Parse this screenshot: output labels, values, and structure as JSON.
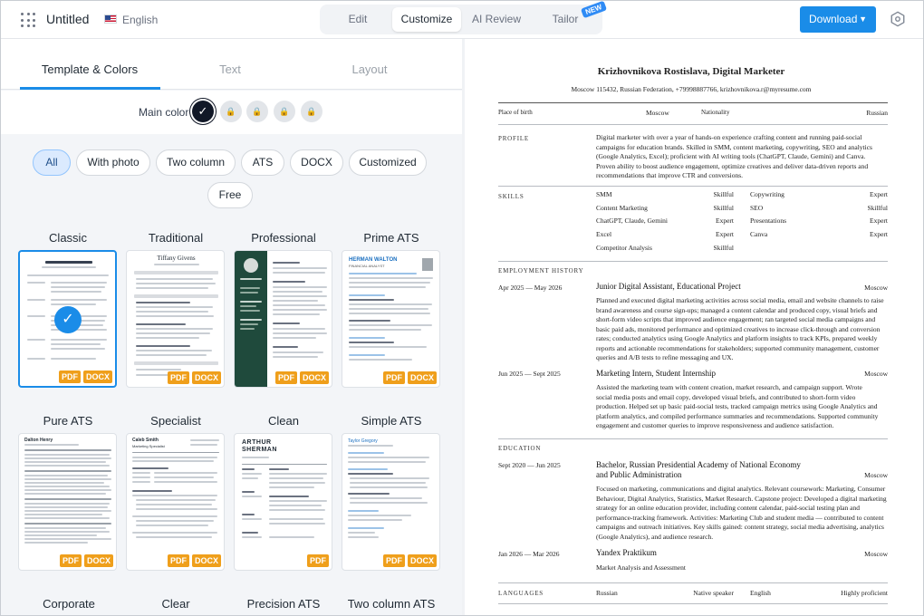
{
  "topbar": {
    "doc_title": "Untitled",
    "language": "English",
    "tabs": [
      "Edit",
      "Customize",
      "AI Review",
      "Tailor"
    ],
    "active_tab": "Customize",
    "new_badge": "NEW",
    "download_label": "Download"
  },
  "left": {
    "sub_tabs": [
      "Template & Colors",
      "Text",
      "Layout"
    ],
    "main_color_label": "Main color",
    "filters": [
      "All",
      "With photo",
      "Two column",
      "ATS",
      "DOCX",
      "Customized",
      "Free"
    ],
    "templates": [
      {
        "name": "Classic",
        "selected": true
      },
      {
        "name": "Traditional"
      },
      {
        "name": "Professional"
      },
      {
        "name": "Prime ATS"
      },
      {
        "name": "Pure ATS"
      },
      {
        "name": "Specialist"
      },
      {
        "name": "Clean"
      },
      {
        "name": "Simple ATS"
      },
      {
        "name": "Corporate"
      },
      {
        "name": "Clear"
      },
      {
        "name": "Precision ATS"
      },
      {
        "name": "Two column ATS"
      }
    ],
    "badge_pdf": "PDF",
    "badge_docx": "DOCX",
    "thumb_texts": {
      "traditional_name": "Tiffany Givens",
      "prime_name": "HERMAN WALTON",
      "prime_role": "FINANCIAL ANALYST",
      "pure_name": "Dalton Henry",
      "specialist_name": "Caleb Smith",
      "specialist_role": "Marketing Specialist",
      "clean_name_1": "ARTHUR",
      "clean_name_2": "SHERMAN",
      "simple_name": "Taylor Gregory"
    }
  },
  "resume": {
    "name": "Krizhovnikova Rostislava, Digital Marketer",
    "contact": "Moscow 115432, Russian Federation, +79998887766, krizhovnikova.r@myresume.com",
    "place_of_birth_label": "Place of birth",
    "place_of_birth": "Moscow",
    "nationality_label": "Nationality",
    "nationality": "Russian",
    "profile_label": "PROFILE",
    "profile_lines": [
      "Digital marketer with over a year of hands-on experience crafting content and running paid-social",
      "campaigns for education brands. Skilled in SMM, content marketing, copywriting, SEO and analytics",
      "(Google Analytics, Excel); proficient with AI writing tools (ChatGPT, Claude, Gemini) and Canva.",
      "Proven ability to boost audience engagement, optimize creatives and deliver data-driven reports and",
      "recommendations that improve CTR and conversions."
    ],
    "skills_label": "SKILLS",
    "skills_left": [
      {
        "name": "SMM",
        "level": "Skillful"
      },
      {
        "name": "Content Marketing",
        "level": "Skillful"
      },
      {
        "name": "ChatGPT, Claude, Gemini",
        "level": "Expert"
      },
      {
        "name": "Excel",
        "level": "Expert"
      },
      {
        "name": "Competitor Analysis",
        "level": "Skillful"
      }
    ],
    "skills_right": [
      {
        "name": "Copywriting",
        "level": "Expert"
      },
      {
        "name": "SEO",
        "level": "Skillful"
      },
      {
        "name": "Presentations",
        "level": "Expert"
      },
      {
        "name": "Canva",
        "level": "Expert"
      }
    ],
    "employment_label": "EMPLOYMENT HISTORY",
    "jobs": [
      {
        "dates": "Apr 2025 — May 2026",
        "title": "Junior Digital Assistant, Educational Project",
        "city": "Moscow",
        "lines": [
          "Planned and executed digital marketing activities across social media, email and website channels to raise",
          "brand awareness and course sign-ups; managed a content calendar and produced copy, visual briefs and",
          "short-form video scripts that improved audience engagement; ran targeted social media campaigns and",
          "basic paid ads, monitored performance and optimized creatives to increase click-through and conversion",
          "rates; conducted analytics using Google Analytics and platform insights to track KPIs, prepared weekly",
          "reports and actionable recommendations for stakeholders; supported community management, customer",
          "queries and A/B tests to refine messaging and UX."
        ]
      },
      {
        "dates": "Jun 2025 — Sept 2025",
        "title": "Marketing Intern, Student Internship",
        "city": "Moscow",
        "lines": [
          "Assisted the marketing team with content creation, market research, and campaign support. Wrote",
          "social media posts and email copy, developed visual briefs, and contributed to short-form video",
          "production. Helped set up basic paid-social tests, tracked campaign metrics using Google Analytics and",
          "platform analytics, and compiled performance summaries and recommendations. Supported community",
          "engagement and customer queries to improve responsiveness and audience satisfaction."
        ]
      }
    ],
    "education_label": "EDUCATION",
    "education": [
      {
        "dates": "Sept 2020 — Jun 2025",
        "title_lines": [
          "Bachelor, Russian Presidential Academy of National Economy",
          "and Public Administration"
        ],
        "city": "Moscow",
        "lines": [
          "Focused on marketing, communications and digital analytics. Relevant coursework: Marketing, Consumer",
          "Behaviour, Digital Analytics, Statistics, Market Research. Capstone project: Developed a digital marketing",
          "strategy for an online education provider, including content calendar, paid-social testing plan and",
          "performance-tracking framework. Activities: Marketing Club and student media — contributed to content",
          "campaigns and outreach initiatives. Key skills gained: content strategy, social media advertising, analytics",
          "(Google Analytics), and audience research."
        ]
      },
      {
        "dates": "Jan 2026 — Mar 2026",
        "title_lines": [
          "Yandex Praktikum"
        ],
        "city": "Moscow",
        "lines": [
          "Market Analysis and Assessment"
        ]
      }
    ],
    "languages_label": "LANGUAGES",
    "languages": [
      {
        "name": "Russian",
        "level": "Native speaker"
      },
      {
        "name": "English",
        "level": "Highly proficient"
      }
    ]
  },
  "colors": {
    "accent": "#1a8ce8",
    "badge": "#ef9f1b",
    "selected_swatch": "#111827"
  }
}
